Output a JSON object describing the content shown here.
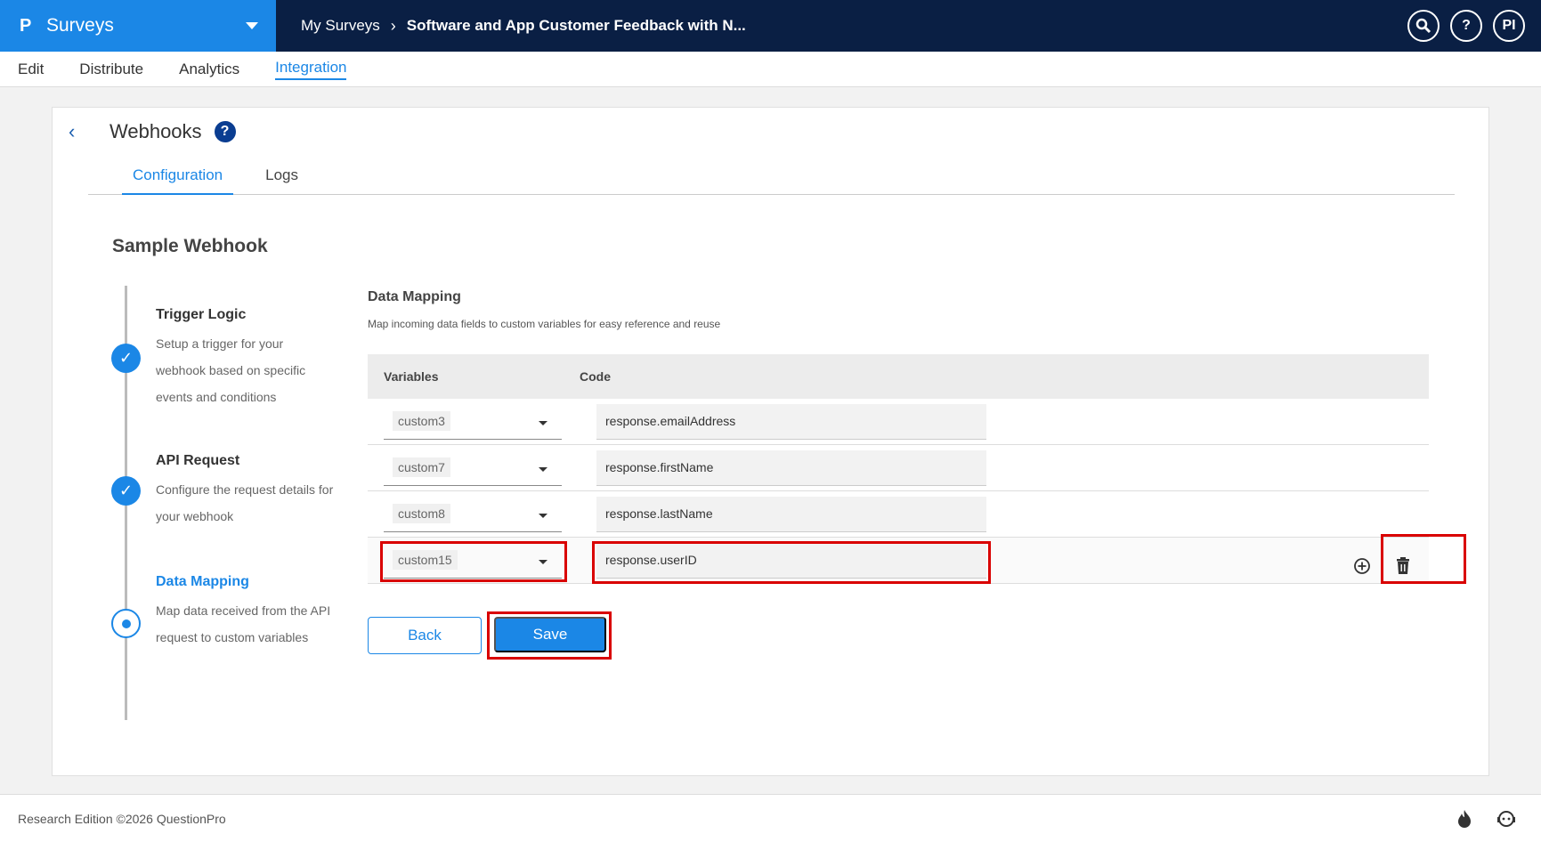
{
  "brand": {
    "logo": "P",
    "name": "Surveys"
  },
  "breadcrumb": {
    "parent": "My Surveys",
    "current": "Software and App Customer Feedback with N..."
  },
  "top_icons": {
    "user_initials": "PI"
  },
  "nav": [
    "Edit",
    "Distribute",
    "Analytics",
    "Integration"
  ],
  "card": {
    "title": "Webhooks",
    "help": "?",
    "tabs": [
      "Configuration",
      "Logs"
    ],
    "webhook_name": "Sample Webhook"
  },
  "steps": [
    {
      "title": "Trigger Logic",
      "desc": "Setup a trigger for your webhook based on specific events and conditions"
    },
    {
      "title": "API Request",
      "desc": "Configure the request details for your webhook"
    },
    {
      "title": "Data Mapping",
      "desc": "Map data received from the API request to custom variables"
    }
  ],
  "data_mapping": {
    "title": "Data Mapping",
    "subtitle": "Map incoming data fields to custom variables for easy reference and reuse",
    "headers": {
      "variables": "Variables",
      "code": "Code"
    },
    "rows": [
      {
        "variable": "custom3",
        "code": "response.emailAddress"
      },
      {
        "variable": "custom7",
        "code": "response.firstName"
      },
      {
        "variable": "custom8",
        "code": "response.lastName"
      },
      {
        "variable": "custom15",
        "code": "response.userID"
      }
    ]
  },
  "buttons": {
    "back": "Back",
    "save": "Save"
  },
  "footer": {
    "text": "Research Edition ©2026 QuestionPro"
  },
  "colors": {
    "accent": "#1b87e6",
    "topbar": "#0a1f44",
    "highlight": "#d90000"
  }
}
